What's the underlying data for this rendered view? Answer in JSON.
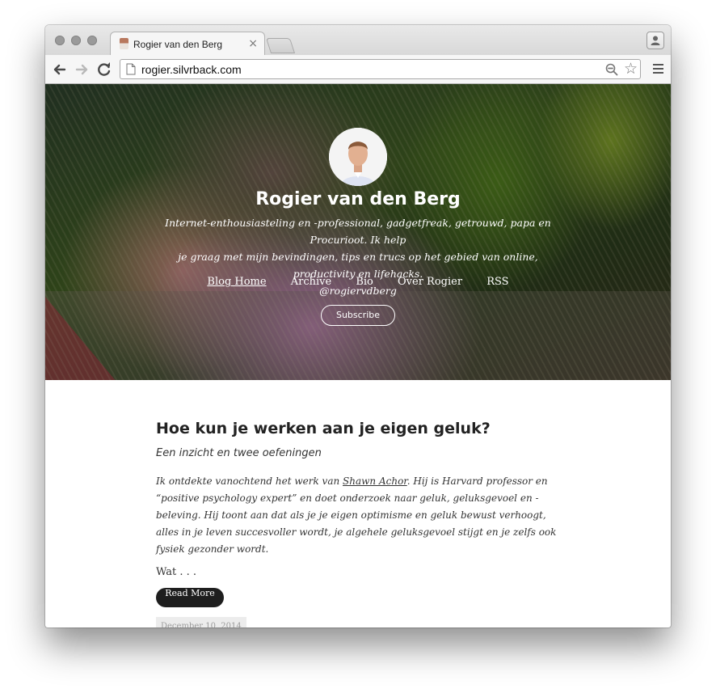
{
  "browser": {
    "tab_title": "Rogier van den Berg",
    "tab_close": "×",
    "url": "rogier.silvrback.com",
    "star": "☆"
  },
  "hero": {
    "name": "Rogier van den Berg",
    "bio_line1": "Internet-enthousiasteling en -professional, gadgetfreak, getrouwd, papa en Procurioot. Ik help",
    "bio_line2": "je graag met mijn bevindingen, tips en trucs op het gebied van online, productivity en lifehacks.",
    "handle": "@rogiervdberg",
    "nav": [
      "Blog Home",
      "Archive",
      "Bio",
      "Over Rogier",
      "RSS"
    ],
    "subscribe_label": "Subscribe"
  },
  "post": {
    "title": "Hoe kun je werken aan je eigen geluk?",
    "subtitle": "Een inzicht en twee oefeningen",
    "excerpt_before_link": "Ik ontdekte vanochtend het werk van ",
    "excerpt_link": "Shawn Achor",
    "excerpt_after_link": ". Hij is Harvard professor en “positive psychology expert” en doet onderzoek naar geluk, geluksgevoel en -beleving. Hij toont aan dat als je je eigen optimisme en geluk bewust verhoogt, alles in je leven succesvoller wordt, je algehele geluksgevoel stijgt en je zelfs ook fysiek gezonder wordt.",
    "more_text": "Wat . . .",
    "read_more_label": "Read More",
    "date": "December 10, 2014"
  }
}
